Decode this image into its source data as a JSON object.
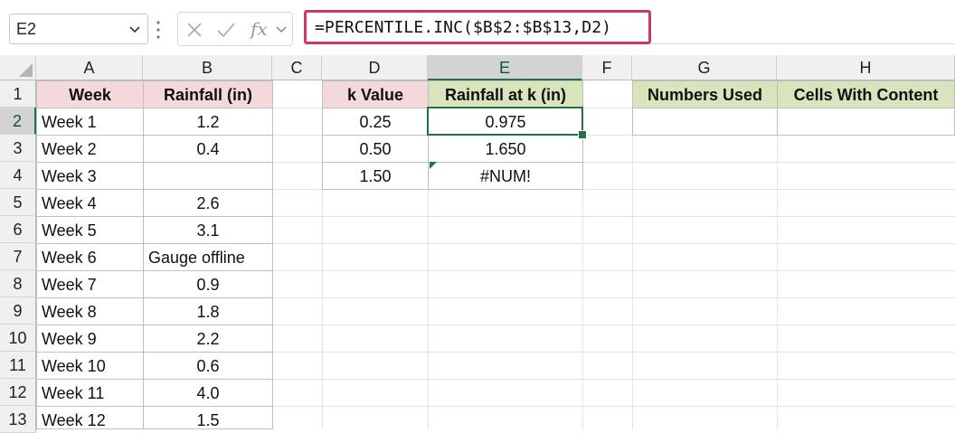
{
  "name_box": {
    "value": "E2"
  },
  "formula_bar": {
    "formula": "=PERCENTILE.INC($B$2:$B$13,D2)",
    "fx_label": "fx"
  },
  "columns": [
    "A",
    "B",
    "C",
    "D",
    "E",
    "F",
    "G",
    "H"
  ],
  "rows": [
    "1",
    "2",
    "3",
    "4",
    "5",
    "6",
    "7",
    "8",
    "9",
    "10",
    "11",
    "12",
    "13"
  ],
  "table1": {
    "headers": [
      "Week",
      "Rainfall (in)"
    ],
    "rows": [
      [
        "Week 1",
        "1.2"
      ],
      [
        "Week 2",
        "0.4"
      ],
      [
        "Week 3",
        ""
      ],
      [
        "Week 4",
        "2.6"
      ],
      [
        "Week 5",
        "3.1"
      ],
      [
        "Week 6",
        "Gauge offline"
      ],
      [
        "Week 7",
        "0.9"
      ],
      [
        "Week 8",
        "1.8"
      ],
      [
        "Week 9",
        "2.2"
      ],
      [
        "Week 10",
        "0.6"
      ],
      [
        "Week 11",
        "4.0"
      ],
      [
        "Week 12",
        "1.5"
      ]
    ]
  },
  "table2": {
    "headers": [
      "k Value",
      "Rainfall at k (in)"
    ],
    "rows": [
      [
        "0.25",
        "0.975"
      ],
      [
        "0.50",
        "1.650"
      ],
      [
        "1.50",
        "#NUM!"
      ]
    ]
  },
  "table3": {
    "headers": [
      "Numbers Used",
      "Cells With Content"
    ],
    "rows": [
      [
        "",
        ""
      ]
    ]
  },
  "selection": {
    "active_cell": "E2",
    "accent_color": "#217346"
  },
  "colors": {
    "formula_highlight": "#d03a5a",
    "header_pink": "#f3d9d9",
    "header_green": "#d8e4bc"
  }
}
